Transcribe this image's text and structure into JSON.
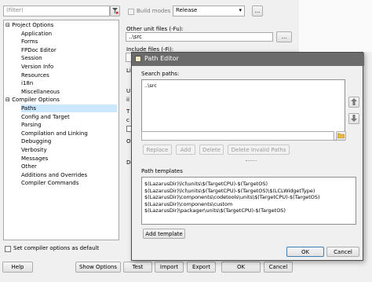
{
  "left_panel": {
    "filter_placeholder": "(filter)",
    "tree": [
      {
        "label": "Project Options",
        "expander": "⊟"
      },
      {
        "label": "Application"
      },
      {
        "label": "Forms"
      },
      {
        "label": "FPDoc Editor"
      },
      {
        "label": "Session"
      },
      {
        "label": "Version Info"
      },
      {
        "label": "Resources"
      },
      {
        "label": "i18n"
      },
      {
        "label": "Miscellaneous"
      },
      {
        "label": "Compiler Options",
        "expander": "⊟"
      },
      {
        "label": "Paths"
      },
      {
        "label": "Config and Target"
      },
      {
        "label": "Parsing"
      },
      {
        "label": "Compilation and Linking"
      },
      {
        "label": "Debugging"
      },
      {
        "label": "Verbosity"
      },
      {
        "label": "Messages"
      },
      {
        "label": "Other"
      },
      {
        "label": "Additions and Overrides"
      },
      {
        "label": "Compiler Commands"
      }
    ],
    "set_default_label": "Set compiler options as default"
  },
  "build_modes": {
    "label": "Build modes",
    "value": "Release",
    "more_button": "..."
  },
  "paths": {
    "other_unit_files_label": "Other unit files (-Fu):",
    "other_unit_files_value": "..\\src",
    "include_files_label": "Include files (-Fi):",
    "browse_button": "...",
    "partial_labels": [
      "Li",
      "U",
      "ii",
      "T",
      "c",
      "Ot",
      "De"
    ]
  },
  "bottom_buttons": {
    "help": "Help",
    "show_options": "Show Options",
    "test": "Test",
    "import": "Import",
    "export": "Export",
    "ok": "OK",
    "cancel": "Cancel"
  },
  "path_editor": {
    "title": "Path Editor",
    "search_paths_label": "Search paths:",
    "search_paths": [
      "..\\src"
    ],
    "buttons": {
      "replace": "Replace",
      "add": "Add",
      "delete": "Delete",
      "delete_invalid": "Delete Invalid Paths"
    },
    "templates_label": "Path templates",
    "templates": [
      "$(LazarusDir)\\lcl\\units\\$(TargetCPU)-$(TargetOS)",
      "$(LazarusDir)\\lcl\\units\\$(TargetCPU)-$(TargetOS)\\$(LCLWidgetType)",
      "$(LazarusDir)\\components\\codetools\\units\\$(TargetCPU)-$(TargetOS)",
      "$(LazarusDir)\\components\\custom",
      "$(LazarusDir)\\packager\\units\\$(TargetCPU)-$(TargetOS)"
    ],
    "add_template": "Add template",
    "ok": "OK",
    "cancel": "Cancel"
  },
  "colors": {
    "selection": "#cce8ff",
    "titlebar": "#6b6b6b"
  }
}
